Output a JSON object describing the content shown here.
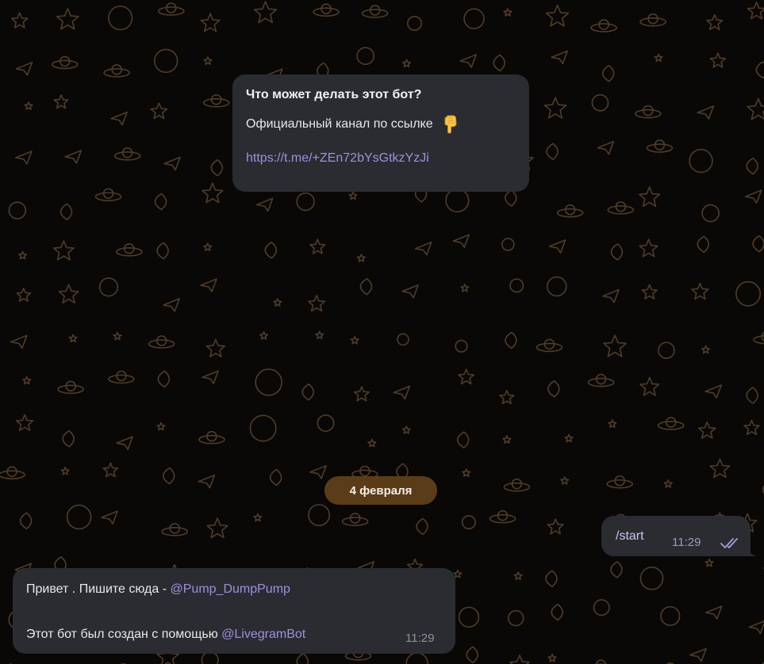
{
  "intro": {
    "title": "Что может делать этот бот?",
    "body": "Официальный канал по ссылке",
    "link": "https://t.me/+ZEn72bYsGtkzYzJi"
  },
  "date_separator": "4 февраля",
  "outgoing": {
    "text": "/start",
    "time": "11:29"
  },
  "incoming": {
    "line1_prefix": "Привет . Пишите сюда - ",
    "line1_mention": "@Pump_DumpPump",
    "line2_prefix": "Этот бот был создан с помощью ",
    "line2_mention": "@LivegramBot",
    "time": "11:29"
  },
  "icons": {
    "hand": "pointing-down-hand-icon",
    "read": "double-check-icon"
  },
  "colors": {
    "bubble": "#2a2c31",
    "link": "#9f8ee0",
    "date_pill": "#5b3c19",
    "wallpaper_doodle": "#5a4630"
  }
}
